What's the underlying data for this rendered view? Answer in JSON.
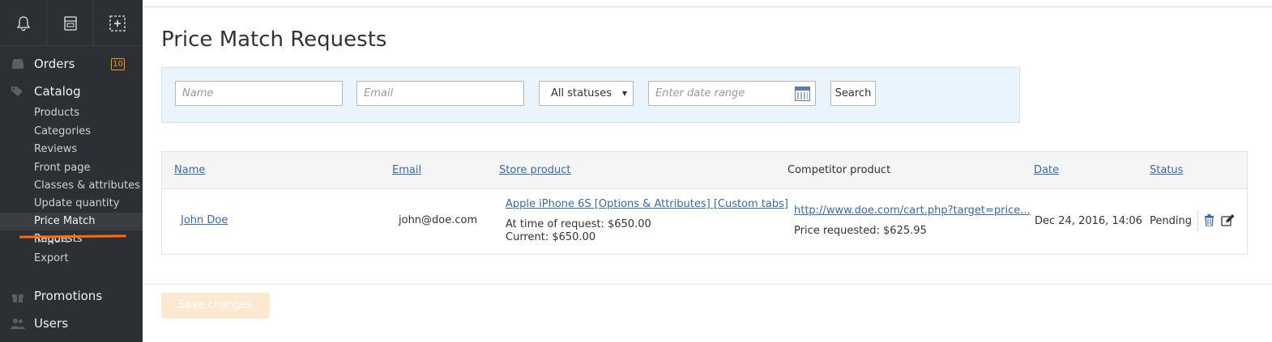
{
  "sidebar": {
    "top_icons": [
      "bell-icon",
      "store-icon",
      "add-box-icon"
    ],
    "orders": {
      "label": "Orders",
      "badge": "10",
      "icon": "inbox-icon"
    },
    "catalog": {
      "label": "Catalog",
      "icon": "tags-icon"
    },
    "catalog_items": [
      "Products",
      "Categories",
      "Reviews",
      "Front page",
      "Classes & attributes",
      "Update quantity",
      "Price Match Requests",
      "Import",
      "Export"
    ],
    "promotions": {
      "label": "Promotions",
      "icon": "gift-icon"
    },
    "users": {
      "label": "Users",
      "icon": "users-icon"
    },
    "underline_color": "#ff6a13"
  },
  "page": {
    "title": "Price Match Requests"
  },
  "filters": {
    "name_placeholder": "Name",
    "email_placeholder": "Email",
    "status_selected": "All statuses",
    "date_placeholder": "Enter date range",
    "search_label": "Search"
  },
  "table": {
    "headers": {
      "name": "Name",
      "email": "Email",
      "store_product": "Store product",
      "competitor_product": "Competitor product",
      "date": "Date",
      "status": "Status"
    },
    "rows": [
      {
        "name": "John Doe",
        "email": "john@doe.com",
        "store_product": "Apple iPhone 6S [Options & Attributes] [Custom tabs]",
        "price_at_request": "At time of request: $650.00",
        "price_current": "Current: $650.00",
        "competitor_url": "http://www.doe.com/cart.php?target=price...",
        "price_requested": "Price requested: $625.95",
        "date": "Dec 24, 2016, 14:06",
        "status": "Pending"
      }
    ]
  },
  "footer": {
    "save_label": "Save changes"
  },
  "colors": {
    "accent": "#3b6aa0",
    "filter_bg": "#e9f4fd",
    "sidebar_bg": "#2c2f33",
    "badge": "#f39c12"
  }
}
